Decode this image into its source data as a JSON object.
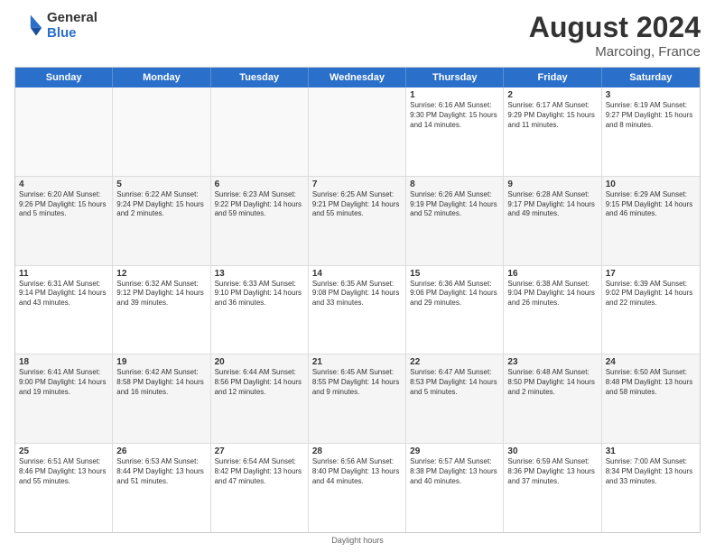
{
  "header": {
    "logo_general": "General",
    "logo_blue": "Blue",
    "title": "August 2024",
    "location": "Marcoing, France"
  },
  "days": [
    "Sunday",
    "Monday",
    "Tuesday",
    "Wednesday",
    "Thursday",
    "Friday",
    "Saturday"
  ],
  "footer": "Daylight hours",
  "weeks": [
    [
      {
        "day": "",
        "info": ""
      },
      {
        "day": "",
        "info": ""
      },
      {
        "day": "",
        "info": ""
      },
      {
        "day": "",
        "info": ""
      },
      {
        "day": "1",
        "info": "Sunrise: 6:16 AM\nSunset: 9:30 PM\nDaylight: 15 hours\nand 14 minutes."
      },
      {
        "day": "2",
        "info": "Sunrise: 6:17 AM\nSunset: 9:29 PM\nDaylight: 15 hours\nand 11 minutes."
      },
      {
        "day": "3",
        "info": "Sunrise: 6:19 AM\nSunset: 9:27 PM\nDaylight: 15 hours\nand 8 minutes."
      }
    ],
    [
      {
        "day": "4",
        "info": "Sunrise: 6:20 AM\nSunset: 9:26 PM\nDaylight: 15 hours\nand 5 minutes."
      },
      {
        "day": "5",
        "info": "Sunrise: 6:22 AM\nSunset: 9:24 PM\nDaylight: 15 hours\nand 2 minutes."
      },
      {
        "day": "6",
        "info": "Sunrise: 6:23 AM\nSunset: 9:22 PM\nDaylight: 14 hours\nand 59 minutes."
      },
      {
        "day": "7",
        "info": "Sunrise: 6:25 AM\nSunset: 9:21 PM\nDaylight: 14 hours\nand 55 minutes."
      },
      {
        "day": "8",
        "info": "Sunrise: 6:26 AM\nSunset: 9:19 PM\nDaylight: 14 hours\nand 52 minutes."
      },
      {
        "day": "9",
        "info": "Sunrise: 6:28 AM\nSunset: 9:17 PM\nDaylight: 14 hours\nand 49 minutes."
      },
      {
        "day": "10",
        "info": "Sunrise: 6:29 AM\nSunset: 9:15 PM\nDaylight: 14 hours\nand 46 minutes."
      }
    ],
    [
      {
        "day": "11",
        "info": "Sunrise: 6:31 AM\nSunset: 9:14 PM\nDaylight: 14 hours\nand 43 minutes."
      },
      {
        "day": "12",
        "info": "Sunrise: 6:32 AM\nSunset: 9:12 PM\nDaylight: 14 hours\nand 39 minutes."
      },
      {
        "day": "13",
        "info": "Sunrise: 6:33 AM\nSunset: 9:10 PM\nDaylight: 14 hours\nand 36 minutes."
      },
      {
        "day": "14",
        "info": "Sunrise: 6:35 AM\nSunset: 9:08 PM\nDaylight: 14 hours\nand 33 minutes."
      },
      {
        "day": "15",
        "info": "Sunrise: 6:36 AM\nSunset: 9:06 PM\nDaylight: 14 hours\nand 29 minutes."
      },
      {
        "day": "16",
        "info": "Sunrise: 6:38 AM\nSunset: 9:04 PM\nDaylight: 14 hours\nand 26 minutes."
      },
      {
        "day": "17",
        "info": "Sunrise: 6:39 AM\nSunset: 9:02 PM\nDaylight: 14 hours\nand 22 minutes."
      }
    ],
    [
      {
        "day": "18",
        "info": "Sunrise: 6:41 AM\nSunset: 9:00 PM\nDaylight: 14 hours\nand 19 minutes."
      },
      {
        "day": "19",
        "info": "Sunrise: 6:42 AM\nSunset: 8:58 PM\nDaylight: 14 hours\nand 16 minutes."
      },
      {
        "day": "20",
        "info": "Sunrise: 6:44 AM\nSunset: 8:56 PM\nDaylight: 14 hours\nand 12 minutes."
      },
      {
        "day": "21",
        "info": "Sunrise: 6:45 AM\nSunset: 8:55 PM\nDaylight: 14 hours\nand 9 minutes."
      },
      {
        "day": "22",
        "info": "Sunrise: 6:47 AM\nSunset: 8:53 PM\nDaylight: 14 hours\nand 5 minutes."
      },
      {
        "day": "23",
        "info": "Sunrise: 6:48 AM\nSunset: 8:50 PM\nDaylight: 14 hours\nand 2 minutes."
      },
      {
        "day": "24",
        "info": "Sunrise: 6:50 AM\nSunset: 8:48 PM\nDaylight: 13 hours\nand 58 minutes."
      }
    ],
    [
      {
        "day": "25",
        "info": "Sunrise: 6:51 AM\nSunset: 8:46 PM\nDaylight: 13 hours\nand 55 minutes."
      },
      {
        "day": "26",
        "info": "Sunrise: 6:53 AM\nSunset: 8:44 PM\nDaylight: 13 hours\nand 51 minutes."
      },
      {
        "day": "27",
        "info": "Sunrise: 6:54 AM\nSunset: 8:42 PM\nDaylight: 13 hours\nand 47 minutes."
      },
      {
        "day": "28",
        "info": "Sunrise: 6:56 AM\nSunset: 8:40 PM\nDaylight: 13 hours\nand 44 minutes."
      },
      {
        "day": "29",
        "info": "Sunrise: 6:57 AM\nSunset: 8:38 PM\nDaylight: 13 hours\nand 40 minutes."
      },
      {
        "day": "30",
        "info": "Sunrise: 6:59 AM\nSunset: 8:36 PM\nDaylight: 13 hours\nand 37 minutes."
      },
      {
        "day": "31",
        "info": "Sunrise: 7:00 AM\nSunset: 8:34 PM\nDaylight: 13 hours\nand 33 minutes."
      }
    ]
  ]
}
